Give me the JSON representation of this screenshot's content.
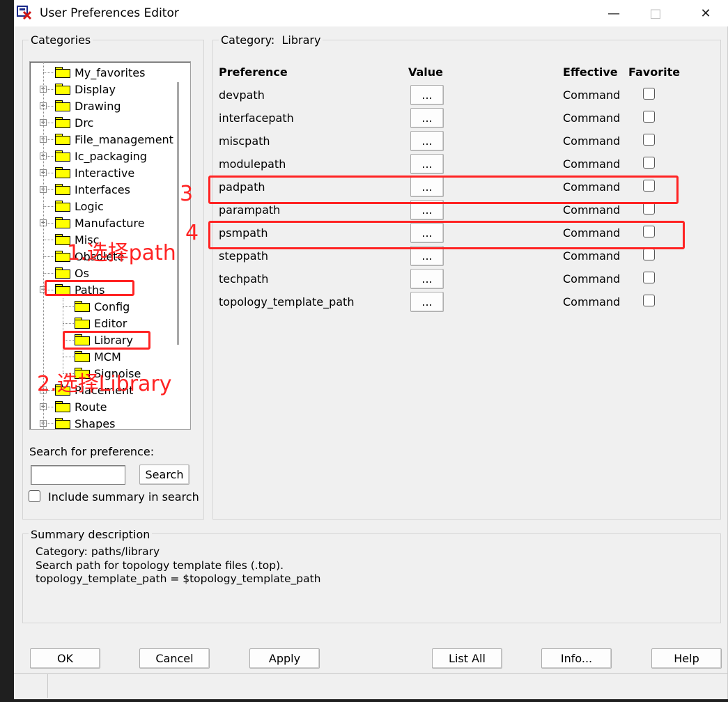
{
  "window": {
    "title": "User Preferences Editor"
  },
  "categories": {
    "label": "Categories",
    "tree": [
      {
        "label": "My_favorites",
        "expandable": false,
        "level": 0
      },
      {
        "label": "Display",
        "expandable": true,
        "level": 0
      },
      {
        "label": "Drawing",
        "expandable": true,
        "level": 0
      },
      {
        "label": "Drc",
        "expandable": true,
        "level": 0
      },
      {
        "label": "File_management",
        "expandable": true,
        "level": 0
      },
      {
        "label": "Ic_packaging",
        "expandable": true,
        "level": 0
      },
      {
        "label": "Interactive",
        "expandable": true,
        "level": 0
      },
      {
        "label": "Interfaces",
        "expandable": true,
        "level": 0
      },
      {
        "label": "Logic",
        "expandable": false,
        "level": 0
      },
      {
        "label": "Manufacture",
        "expandable": true,
        "level": 0
      },
      {
        "label": "Misc",
        "expandable": false,
        "level": 0
      },
      {
        "label": "Obsolete",
        "expandable": false,
        "level": 0
      },
      {
        "label": "Os",
        "expandable": false,
        "level": 0
      },
      {
        "label": "Paths",
        "expandable": true,
        "expanded": true,
        "level": 0
      },
      {
        "label": "Config",
        "expandable": false,
        "level": 1
      },
      {
        "label": "Editor",
        "expandable": false,
        "level": 1
      },
      {
        "label": "Library",
        "expandable": false,
        "level": 1,
        "selected": true
      },
      {
        "label": "MCM",
        "expandable": false,
        "level": 1
      },
      {
        "label": "Signoise",
        "expandable": false,
        "level": 1
      },
      {
        "label": "Placement",
        "expandable": true,
        "level": 0
      },
      {
        "label": "Route",
        "expandable": true,
        "level": 0
      },
      {
        "label": "Shapes",
        "expandable": true,
        "level": 0
      }
    ]
  },
  "search": {
    "label": "Search for preference:",
    "value": "",
    "button": "Search",
    "include_summary_label": "Include summary in search",
    "include_summary_checked": false
  },
  "category_panel": {
    "caption": "Category:",
    "name": "Library",
    "headers": {
      "preference": "Preference",
      "value": "Value",
      "effective": "Effective",
      "favorite": "Favorite"
    },
    "rows": [
      {
        "preference": "devpath",
        "value_button": "...",
        "effective": "Command",
        "favorite": false
      },
      {
        "preference": "interfacepath",
        "value_button": "...",
        "effective": "Command",
        "favorite": false
      },
      {
        "preference": "miscpath",
        "value_button": "...",
        "effective": "Command",
        "favorite": false
      },
      {
        "preference": "modulepath",
        "value_button": "...",
        "effective": "Command",
        "favorite": false
      },
      {
        "preference": "padpath",
        "value_button": "...",
        "effective": "Command",
        "favorite": false
      },
      {
        "preference": "parampath",
        "value_button": "...",
        "effective": "Command",
        "favorite": false
      },
      {
        "preference": "psmpath",
        "value_button": "...",
        "effective": "Command",
        "favorite": false
      },
      {
        "preference": "steppath",
        "value_button": "...",
        "effective": "Command",
        "favorite": false
      },
      {
        "preference": "techpath",
        "value_button": "...",
        "effective": "Command",
        "favorite": false
      },
      {
        "preference": "topology_template_path",
        "value_button": "...",
        "effective": "Command",
        "favorite": false
      }
    ]
  },
  "summary": {
    "label": "Summary description",
    "lines": [
      "Category: paths/library",
      "Search path for topology template files (.top).",
      "topology_template_path = $topology_template_path"
    ]
  },
  "buttons": {
    "ok": "OK",
    "cancel": "Cancel",
    "apply": "Apply",
    "list_all": "List All",
    "info": "Info...",
    "help": "Help"
  },
  "annotations": {
    "step1": "1.选择path",
    "step2": "2.选择Library",
    "step3": "3",
    "step4": "4",
    "color": "#ff2323"
  }
}
